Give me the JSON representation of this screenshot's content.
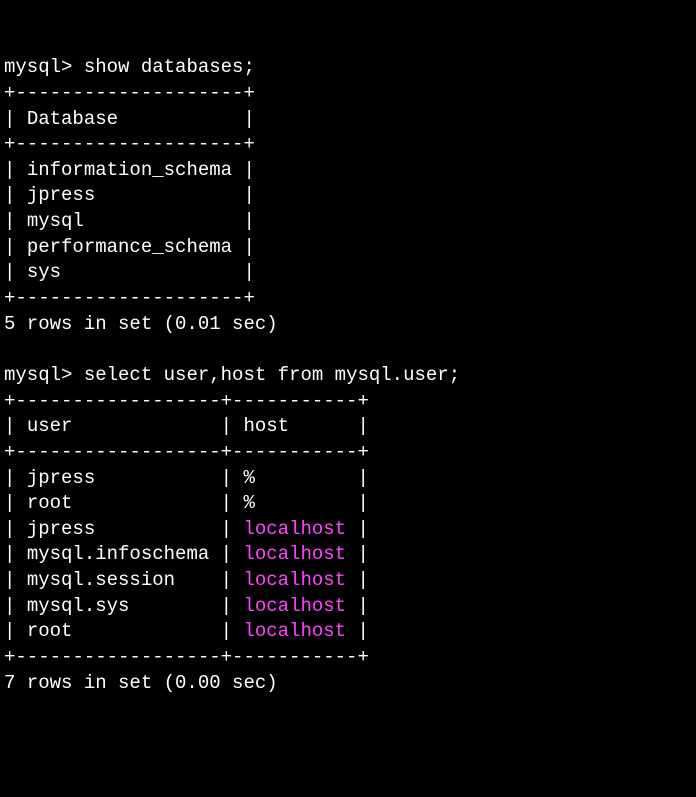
{
  "prompt": "mysql> ",
  "query1": {
    "command": "show databases;",
    "header": "Database",
    "rows": [
      "information_schema",
      "jpress",
      "mysql",
      "performance_schema",
      "sys"
    ],
    "status": "5 rows in set (0.01 sec)"
  },
  "query2": {
    "command": "select user,host from mysql.user;",
    "headers": {
      "col1": "user",
      "col2": "host"
    },
    "rows": [
      {
        "user": "jpress",
        "host": "%",
        "highlight": false
      },
      {
        "user": "root",
        "host": "%",
        "highlight": false
      },
      {
        "user": "jpress",
        "host": "localhost",
        "highlight": true
      },
      {
        "user": "mysql.infoschema",
        "host": "localhost",
        "highlight": true
      },
      {
        "user": "mysql.session",
        "host": "localhost",
        "highlight": true
      },
      {
        "user": "mysql.sys",
        "host": "localhost",
        "highlight": true
      },
      {
        "user": "root",
        "host": "localhost",
        "highlight": true
      }
    ],
    "status": "7 rows in set (0.00 sec)"
  },
  "chart_data": {
    "type": "table",
    "title": "MySQL CLI output",
    "tables": [
      {
        "name": "databases",
        "columns": [
          "Database"
        ],
        "data": [
          [
            "information_schema"
          ],
          [
            "jpress"
          ],
          [
            "mysql"
          ],
          [
            "performance_schema"
          ],
          [
            "sys"
          ]
        ],
        "row_count": 5,
        "elapsed_sec": 0.01
      },
      {
        "name": "mysql.user",
        "columns": [
          "user",
          "host"
        ],
        "data": [
          [
            "jpress",
            "%"
          ],
          [
            "root",
            "%"
          ],
          [
            "jpress",
            "localhost"
          ],
          [
            "mysql.infoschema",
            "localhost"
          ],
          [
            "mysql.session",
            "localhost"
          ],
          [
            "mysql.sys",
            "localhost"
          ],
          [
            "root",
            "localhost"
          ]
        ],
        "row_count": 7,
        "elapsed_sec": 0.0
      }
    ]
  }
}
